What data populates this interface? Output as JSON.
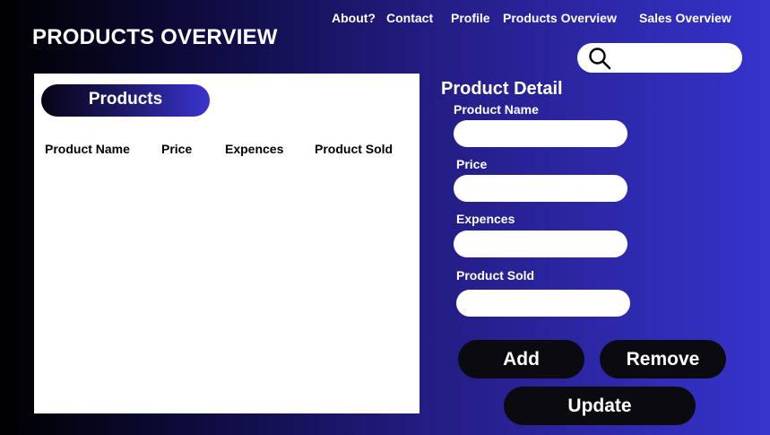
{
  "nav": {
    "about": "About?",
    "contact": "Contact",
    "profile": "Profile",
    "products_overview": "Products Overview",
    "sales_overview": "Sales Overview"
  },
  "page_title": "PRODUCTS OVERVIEW",
  "search": {
    "value": "",
    "placeholder": ""
  },
  "products_panel": {
    "title": "Products",
    "columns": [
      "Product Name",
      "Price",
      "Expences",
      "Product Sold"
    ],
    "rows": []
  },
  "detail": {
    "title": "Product Detail",
    "fields": [
      {
        "label": "Product Name",
        "value": ""
      },
      {
        "label": "Price",
        "value": ""
      },
      {
        "label": "Expences",
        "value": ""
      },
      {
        "label": "Product Sold",
        "value": ""
      }
    ]
  },
  "buttons": {
    "add": "Add",
    "remove": "Remove",
    "update": "Update"
  },
  "colors": {
    "button_bg": "#0b0b0f",
    "panel_bg": "#ffffff",
    "accent": "#3633cc"
  }
}
